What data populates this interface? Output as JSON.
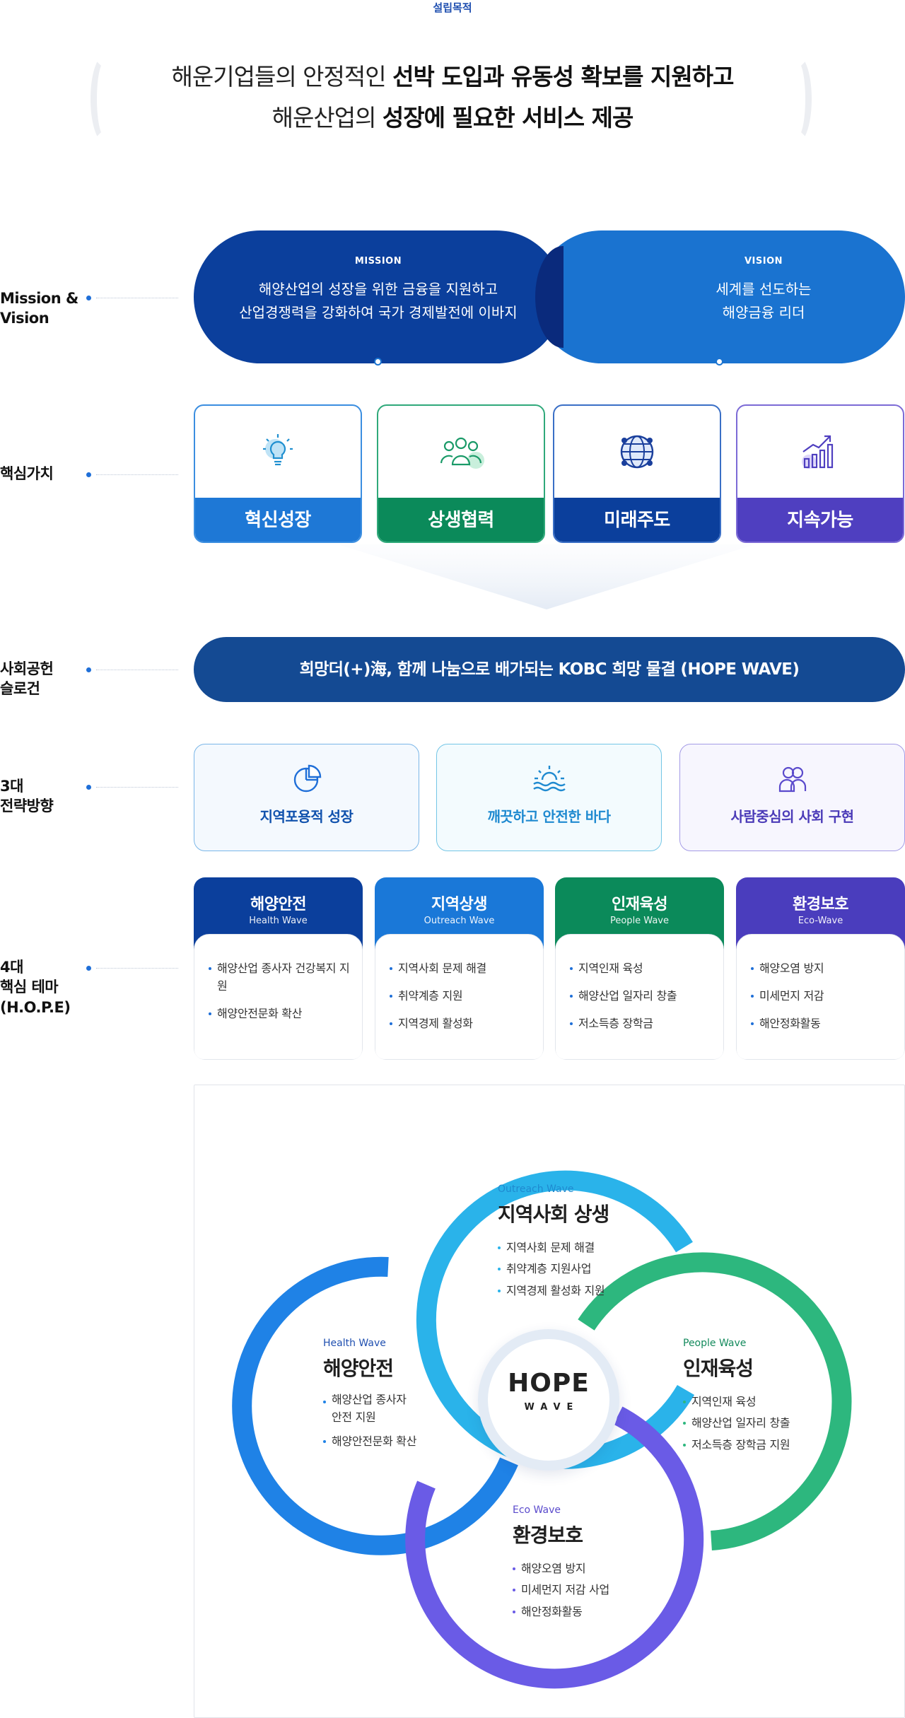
{
  "purpose": {
    "tag": "설립목적",
    "line1_normal": "해운기업들의 안정적인 ",
    "line1_bold": "선박 도입과 유동성 확보를 지원하고",
    "line2_normal": "해운산업의 ",
    "line2_bold": "성장에 필요한 서비스 제공"
  },
  "rows": {
    "mission_vision": "Mission &\nVision",
    "core_values": "핵심가치",
    "slogan": "사회공헌\n슬로건",
    "strategy": "3대\n전략방향",
    "themes": "4대\n핵심 테마\n(H.O.P.E)"
  },
  "mission": {
    "caption": "MISSION",
    "text": "해양산업의 성장을 위한 금융을 지원하고\n산업경쟁력을 강화하여 국가 경제발전에 이바지"
  },
  "vision": {
    "caption": "VISION",
    "text": "세계를 선도하는\n해양금융 리더"
  },
  "core_values": [
    {
      "label": "혁신성장",
      "icon": "lightbulb-icon",
      "color": "#1e78d6"
    },
    {
      "label": "상생협력",
      "icon": "people-icon",
      "color": "#0b8a5a"
    },
    {
      "label": "미래주도",
      "icon": "globe-icon",
      "color": "#0b3f9c"
    },
    {
      "label": "지속가능",
      "icon": "growth-chart-icon",
      "color": "#4f3fc0"
    }
  ],
  "slogan": "희망더(+)海, 함께 나눔으로 배가되는 KOBC 희망 물결 (HOPE WAVE)",
  "strategy": [
    {
      "label": "지역포용적 성장",
      "icon": "pie-chart-icon",
      "color": "#1152ad"
    },
    {
      "label": "깨끗하고 안전한 바다",
      "icon": "sea-sun-icon",
      "color": "#1f8ad0"
    },
    {
      "label": "사람중심의 사회 구현",
      "icon": "person-pair-icon",
      "color": "#4b3bb8"
    }
  ],
  "themes": [
    {
      "title": "해양안전",
      "sub": "Health Wave",
      "color": "#0b3f9c",
      "items": [
        "해양산업 종사자 건강복지 지원",
        "해양안전문화 확산"
      ]
    },
    {
      "title": "지역상생",
      "sub": "Outreach Wave",
      "color": "#1a78d8",
      "items": [
        "지역사회 문제 해결",
        "취약계층 지원",
        "지역경제 활성화"
      ]
    },
    {
      "title": "인재육성",
      "sub": "People Wave",
      "color": "#0b8a5a",
      "items": [
        "지역인재 육성",
        "해양산업 일자리 창출",
        "저소득층 장학금"
      ]
    },
    {
      "title": "환경보호",
      "sub": "Eco-Wave",
      "color": "#4a3dbd",
      "items": [
        "해양오염 방지",
        "미세먼지 저감",
        "해안정화활동"
      ]
    }
  ],
  "hope": {
    "center_title": "HOPE",
    "center_sub": "WAVE",
    "outreach": {
      "cap": "Outreach Wave",
      "title": "지역사회 상생",
      "items": [
        "지역사회 문제 해결",
        "취약계층 지원사업",
        "지역경제 활성화 지원"
      ],
      "color": "#2ab3ea"
    },
    "health": {
      "cap": "Health Wave",
      "title": "해양안전",
      "items": [
        "해양산업 종사자\n안전 지원",
        "해양안전문화 확산"
      ],
      "color": "#1f82e6"
    },
    "people": {
      "cap": "People Wave",
      "title": "인재육성",
      "items": [
        "지역인재 육성",
        "해양산업 일자리 창출",
        "저소득층 장학금 지원"
      ],
      "color": "#2db77e"
    },
    "eco": {
      "cap": "Eco Wave",
      "title": "환경보호",
      "items": [
        "해양오염 방지",
        "미세먼지 저감 사업",
        "해안정화활동"
      ],
      "color": "#6a5be6"
    }
  }
}
